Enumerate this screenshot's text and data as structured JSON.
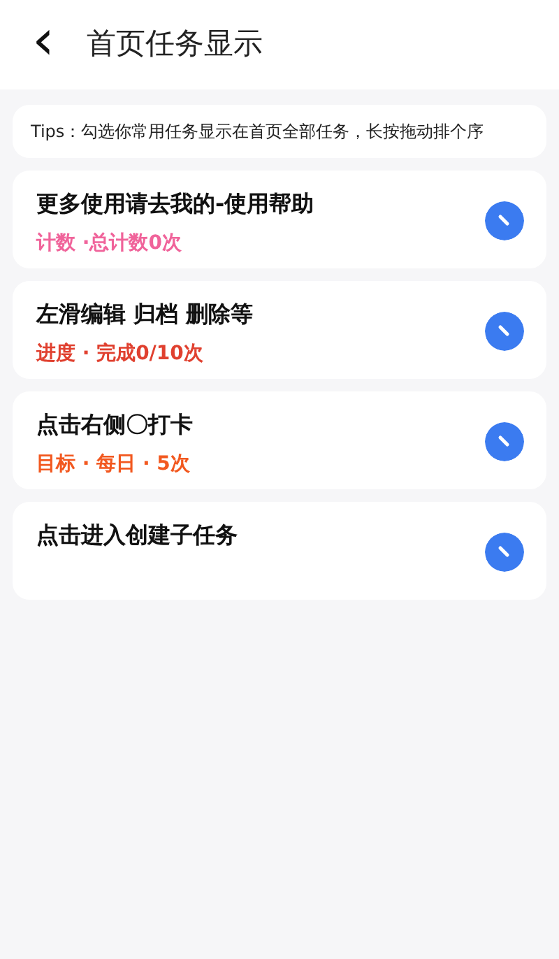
{
  "header": {
    "back": "‹",
    "title": "首页任务显示"
  },
  "tips": "Tips：勾选你常用任务显示在首页全部任务，长按拖动排个序",
  "tasks": [
    {
      "title": "更多使用请去我的-使用帮助",
      "subtitle": "计数 ·总计数0次",
      "color": "#f0639a",
      "checked": true
    },
    {
      "title": "左滑编辑 归档 删除等",
      "subtitle": "进度 · 完成0/10次",
      "color": "#e0402f",
      "checked": true
    },
    {
      "title": "点击右侧〇打卡",
      "subtitle": "目标 · 每日 · 5次",
      "color": "#f2581f",
      "checked": true
    },
    {
      "title": "点击进入创建子任务",
      "checked": true
    }
  ]
}
